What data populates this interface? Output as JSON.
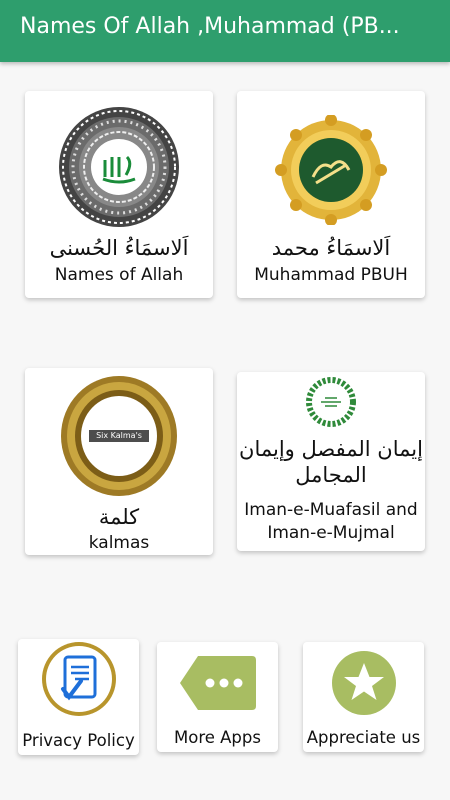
{
  "app_bar": {
    "title": "Names Of Allah ,Muhammad (PB..."
  },
  "cards": [
    {
      "arabic": "اَلاسمَاءُ الحُسنی",
      "english": "Names of Allah"
    },
    {
      "arabic": "اَلاسمَاءُ محمد",
      "english": "Muhammad PBUH"
    },
    {
      "arabic": "كلمة",
      "english": "kalmas",
      "image_text": "Six Kalma's"
    },
    {
      "arabic_line1": "إيمان المفصل وإيمان",
      "arabic_line2": "المجامل",
      "english_line1": "Iman-e-Muafasil and",
      "english_line2": "Iman-e-Mujmal"
    }
  ],
  "bottom_buttons": [
    {
      "label": "Privacy Policy",
      "icon": "document-check-icon",
      "color": "#1e6fd9"
    },
    {
      "label": "More Apps",
      "icon": "more-dots-icon",
      "color": "#a8bd62"
    },
    {
      "label": "Appreciate us",
      "icon": "star-icon",
      "color": "#a8bd62"
    }
  ],
  "colors": {
    "primary": "#2e9e6d",
    "accent_green": "#a8bd62"
  }
}
